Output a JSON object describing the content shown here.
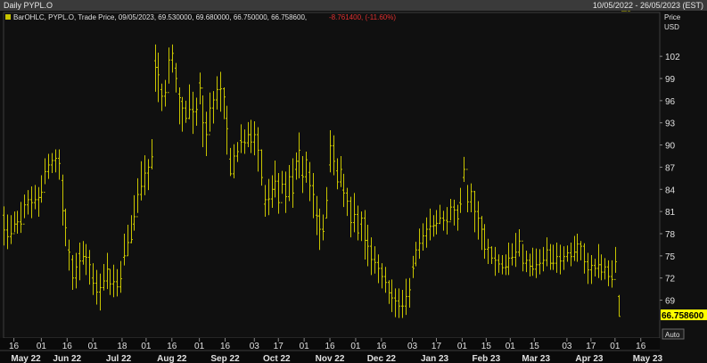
{
  "window": {
    "title": "Daily PYPL.O",
    "date_range": "10/05/2022 - 26/05/2023 (EST)"
  },
  "legend": {
    "series": "BarOHLC, PYPL.O, Trade Price, 09/05/2023, 69.530000, 69.680000, 66.750000, 66.758600,",
    "change": "-8.761400, (-11.60%)"
  },
  "axis": {
    "price_label": "Price",
    "currency_label": "USD",
    "last_price": "66.758600",
    "auto_button": "Auto"
  },
  "colors": {
    "background": "#101010",
    "bars": "#c8c400",
    "grid": "#2c2c2c",
    "text": "#e0e0e0",
    "change_negative": "#e03030",
    "last_price_badge": "#ffff00"
  },
  "chart_data": {
    "type": "ohlc_bar",
    "title": "Daily PYPL.O",
    "ylabel": "Price USD",
    "ylim": [
      64,
      106
    ],
    "yticks": [
      69,
      72,
      75,
      78,
      81,
      84,
      87,
      90,
      93,
      96,
      99,
      102
    ],
    "xlim": [
      "2022-05-10",
      "2023-05-26"
    ],
    "grid": false,
    "xticks": [
      {
        "date": "2022-05-16",
        "label": "16"
      },
      {
        "date": "2022-06-01",
        "label": "01"
      },
      {
        "date": "2022-06-16",
        "label": "16"
      },
      {
        "date": "2022-07-01",
        "label": "01"
      },
      {
        "date": "2022-07-18",
        "label": "18"
      },
      {
        "date": "2022-08-01",
        "label": "01"
      },
      {
        "date": "2022-08-16",
        "label": "16"
      },
      {
        "date": "2022-09-01",
        "label": "01"
      },
      {
        "date": "2022-09-16",
        "label": "16"
      },
      {
        "date": "2022-10-03",
        "label": "03"
      },
      {
        "date": "2022-10-17",
        "label": "17"
      },
      {
        "date": "2022-11-01",
        "label": "01"
      },
      {
        "date": "2022-11-16",
        "label": "16"
      },
      {
        "date": "2022-12-01",
        "label": "01"
      },
      {
        "date": "2022-12-16",
        "label": "16"
      },
      {
        "date": "2023-01-03",
        "label": "03"
      },
      {
        "date": "2023-01-17",
        "label": "17"
      },
      {
        "date": "2023-02-01",
        "label": "01"
      },
      {
        "date": "2023-02-15",
        "label": "15"
      },
      {
        "date": "2023-03-01",
        "label": "01"
      },
      {
        "date": "2023-03-15",
        "label": "15"
      },
      {
        "date": "2023-04-03",
        "label": "03"
      },
      {
        "date": "2023-04-17",
        "label": "17"
      },
      {
        "date": "2023-05-01",
        "label": "01"
      },
      {
        "date": "2023-05-16",
        "label": "16"
      }
    ],
    "months": [
      {
        "date": "2022-05-23",
        "label": "May 22"
      },
      {
        "date": "2022-06-16",
        "label": "Jun 22"
      },
      {
        "date": "2022-07-16",
        "label": "Jul 22"
      },
      {
        "date": "2022-08-16",
        "label": "Aug 22"
      },
      {
        "date": "2022-09-16",
        "label": "Sep 22"
      },
      {
        "date": "2022-10-16",
        "label": "Oct 22"
      },
      {
        "date": "2022-11-16",
        "label": "Nov 22"
      },
      {
        "date": "2022-12-16",
        "label": "Dec 22"
      },
      {
        "date": "2023-01-16",
        "label": "Jan 23"
      },
      {
        "date": "2023-02-15",
        "label": "Feb 23"
      },
      {
        "date": "2023-03-16",
        "label": "Mar 23"
      },
      {
        "date": "2023-04-16",
        "label": "Apr 23"
      },
      {
        "date": "2023-05-20",
        "label": "May 23"
      }
    ],
    "series": [
      {
        "name": "PYPL.O",
        "x": [
          "2022-05-10",
          "2022-05-12",
          "2022-05-14",
          "2022-05-16",
          "2022-05-18",
          "2022-05-20",
          "2022-05-22",
          "2022-05-24",
          "2022-05-26",
          "2022-05-28",
          "2022-05-30",
          "2022-06-01",
          "2022-06-03",
          "2022-06-05",
          "2022-06-07",
          "2022-06-09",
          "2022-06-11",
          "2022-06-13",
          "2022-06-15",
          "2022-06-17",
          "2022-06-19",
          "2022-06-21",
          "2022-06-23",
          "2022-06-25",
          "2022-06-27",
          "2022-06-29",
          "2022-07-01",
          "2022-07-03",
          "2022-07-05",
          "2022-07-07",
          "2022-07-09",
          "2022-07-11",
          "2022-07-13",
          "2022-07-15",
          "2022-07-17",
          "2022-07-19",
          "2022-07-21",
          "2022-07-23",
          "2022-07-25",
          "2022-07-27",
          "2022-07-29",
          "2022-07-31",
          "2022-08-02",
          "2022-08-04",
          "2022-08-06",
          "2022-08-08",
          "2022-08-10",
          "2022-08-12",
          "2022-08-14",
          "2022-08-16",
          "2022-08-18",
          "2022-08-20",
          "2022-08-22",
          "2022-08-24",
          "2022-08-26",
          "2022-08-28",
          "2022-08-30",
          "2022-09-01",
          "2022-09-03",
          "2022-09-05",
          "2022-09-07",
          "2022-09-09",
          "2022-09-11",
          "2022-09-13",
          "2022-09-15",
          "2022-09-17",
          "2022-09-19",
          "2022-09-21",
          "2022-09-23",
          "2022-09-25",
          "2022-09-27",
          "2022-09-29",
          "2022-10-01",
          "2022-10-03",
          "2022-10-05",
          "2022-10-07",
          "2022-10-09",
          "2022-10-11",
          "2022-10-13",
          "2022-10-15",
          "2022-10-17",
          "2022-10-19",
          "2022-10-21",
          "2022-10-23",
          "2022-10-25",
          "2022-10-27",
          "2022-10-29",
          "2022-10-31",
          "2022-11-02",
          "2022-11-04",
          "2022-11-06",
          "2022-11-08",
          "2022-11-10",
          "2022-11-12",
          "2022-11-14",
          "2022-11-16",
          "2022-11-18",
          "2022-11-20",
          "2022-11-22",
          "2022-11-24",
          "2022-11-26",
          "2022-11-28",
          "2022-11-30",
          "2022-12-02",
          "2022-12-04",
          "2022-12-06",
          "2022-12-08",
          "2022-12-10",
          "2022-12-12",
          "2022-12-14",
          "2022-12-16",
          "2022-12-18",
          "2022-12-20",
          "2022-12-22",
          "2022-12-24",
          "2022-12-26",
          "2022-12-28",
          "2022-12-30",
          "2023-01-01",
          "2023-01-03",
          "2023-01-05",
          "2023-01-07",
          "2023-01-09",
          "2023-01-11",
          "2023-01-13",
          "2023-01-15",
          "2023-01-17",
          "2023-01-19",
          "2023-01-21",
          "2023-01-23",
          "2023-01-25",
          "2023-01-27",
          "2023-01-29",
          "2023-01-31",
          "2023-02-02",
          "2023-02-04",
          "2023-02-06",
          "2023-02-08",
          "2023-02-10",
          "2023-02-12",
          "2023-02-14",
          "2023-02-16",
          "2023-02-18",
          "2023-02-20",
          "2023-02-22",
          "2023-02-24",
          "2023-02-26",
          "2023-02-28",
          "2023-03-02",
          "2023-03-04",
          "2023-03-06",
          "2023-03-08",
          "2023-03-10",
          "2023-03-12",
          "2023-03-14",
          "2023-03-16",
          "2023-03-18",
          "2023-03-20",
          "2023-03-22",
          "2023-03-24",
          "2023-03-26",
          "2023-03-28",
          "2023-03-30",
          "2023-04-01",
          "2023-04-03",
          "2023-04-05",
          "2023-04-07",
          "2023-04-09",
          "2023-04-11",
          "2023-04-13",
          "2023-04-15",
          "2023-04-17",
          "2023-04-19",
          "2023-04-21",
          "2023-04-23",
          "2023-04-25",
          "2023-04-27",
          "2023-04-29",
          "2023-05-01",
          "2023-05-03",
          "2023-05-05",
          "2023-05-07",
          "2023-05-09"
        ],
        "close": [
          78.5,
          77.6,
          78.0,
          79.3,
          79.6,
          79.3,
          81.9,
          82.6,
          82.2,
          82.6,
          82.9,
          83.6,
          86.4,
          87.3,
          87.9,
          88.2,
          87.5,
          81.1,
          78.8,
          75.5,
          72.0,
          73.5,
          74.3,
          74.9,
          74.8,
          73.8,
          71.3,
          70.1,
          70.7,
          71.6,
          73.2,
          71.2,
          71.5,
          70.8,
          71.9,
          75.0,
          76.8,
          77.2,
          80.3,
          83.3,
          84.4,
          86.2,
          87.0,
          88.4,
          100.5,
          99.5,
          96.6,
          97.1,
          101.5,
          102.4,
          99.0,
          96.4,
          95.0,
          93.6,
          94.8,
          94.5,
          94.8,
          97.7,
          93.0,
          91.4,
          95.0,
          96.1,
          97.5,
          97.6,
          96.5,
          92.2,
          86.1,
          88.5,
          89.1,
          90.4,
          90.3,
          91.4,
          90.4,
          91.4,
          89.3,
          85.6,
          82.6,
          82.7,
          84.0,
          85.1,
          82.2,
          84.7,
          83.0,
          85.7,
          83.5,
          87.8,
          89.3,
          85.7,
          88.0,
          84.5,
          83.3,
          80.4,
          78.6,
          78.3,
          82.5,
          89.9,
          87.8,
          85.0,
          86.7,
          83.5,
          82.4,
          79.5,
          80.6,
          78.1,
          80.1,
          77.1,
          76.3,
          74.5,
          74.1,
          73.3,
          72.2,
          71.4,
          70.0,
          69.3,
          68.9,
          68.2,
          68.2,
          69.5,
          70.4,
          73.3,
          75.8,
          76.7,
          77.7,
          78.6,
          79.0,
          79.1,
          79.4,
          80.1,
          79.8,
          79.6,
          81.6,
          81.2,
          80.0,
          82.0,
          86.7,
          82.3,
          83.7,
          81.0,
          80.1,
          78.6,
          75.9,
          76.1,
          74.7,
          74.4,
          73.9,
          73.4,
          73.5,
          74.7,
          74.8,
          75.5,
          77.0,
          74.0,
          74.4,
          73.6,
          73.2,
          73.8,
          74.0,
          74.4,
          75.8,
          74.0,
          74.0,
          74.9,
          74.3,
          74.9,
          75.4,
          74.9,
          75.5,
          76.6,
          76.3,
          74.2,
          73.1,
          73.7,
          73.3,
          73.8,
          72.8,
          73.5,
          72.2,
          71.8,
          74.2,
          66.8
        ],
        "high": [
          81.7,
          80.6,
          80.5,
          81.0,
          81.1,
          82.3,
          83.3,
          83.9,
          84.4,
          84.6,
          84.3,
          85.9,
          88.2,
          88.8,
          88.9,
          89.4,
          89.4,
          86.0,
          81.4,
          77.2,
          75.1,
          75.4,
          76.8,
          77.0,
          76.6,
          75.8,
          74.0,
          73.1,
          72.6,
          73.9,
          75.4,
          73.2,
          73.8,
          73.2,
          74.3,
          78.0,
          79.2,
          80.5,
          83.2,
          85.5,
          87.8,
          88.6,
          88.1,
          90.8,
          103.6,
          102.5,
          98.3,
          98.8,
          103.2,
          103.6,
          101.1,
          97.8,
          96.5,
          96.0,
          98.2,
          97.2,
          96.4,
          99.8,
          96.7,
          94.5,
          97.1,
          97.3,
          99.3,
          99.9,
          97.8,
          95.3,
          89.6,
          90.1,
          90.4,
          92.8,
          92.1,
          93.1,
          93.4,
          93.2,
          92.4,
          89.4,
          84.6,
          85.4,
          85.9,
          87.9,
          86.2,
          86.5,
          86.4,
          87.3,
          88.2,
          89.0,
          91.7,
          88.5,
          89.1,
          87.7,
          86.2,
          83.1,
          81.4,
          80.6,
          84.3,
          92.0,
          91.3,
          88.2,
          88.5,
          86.1,
          84.2,
          83.0,
          83.5,
          81.8,
          81.0,
          81.2,
          79.2,
          77.5,
          76.3,
          75.2,
          74.0,
          73.5,
          71.7,
          71.8,
          70.6,
          70.6,
          70.4,
          71.9,
          72.0,
          75.0,
          76.9,
          78.7,
          79.4,
          80.2,
          81.4,
          80.5,
          81.2,
          81.9,
          81.1,
          81.6,
          82.7,
          82.6,
          81.9,
          84.2,
          88.4,
          84.6,
          84.8,
          83.8,
          82.4,
          80.4,
          79.3,
          77.3,
          76.3,
          76.2,
          75.2,
          75.1,
          75.2,
          76.8,
          76.7,
          78.1,
          78.6,
          76.6,
          75.7,
          75.3,
          76.1,
          76.0,
          75.9,
          76.2,
          77.5,
          76.6,
          76.5,
          76.8,
          76.5,
          76.3,
          76.4,
          76.8,
          77.7,
          78.0,
          77.0,
          76.7,
          75.4,
          75.1,
          74.6,
          76.6,
          75.2,
          74.7,
          74.4,
          74.4,
          76.2,
          69.7
        ],
        "low": [
          76.4,
          75.9,
          76.6,
          78.2,
          78.0,
          78.1,
          80.1,
          80.6,
          80.1,
          81.3,
          80.3,
          82.2,
          84.7,
          85.4,
          86.2,
          86.3,
          85.3,
          79.1,
          76.3,
          73.0,
          70.4,
          70.6,
          71.7,
          73.8,
          72.4,
          71.1,
          69.7,
          68.4,
          67.6,
          70.3,
          70.5,
          69.7,
          69.4,
          69.5,
          70.0,
          73.7,
          75.0,
          76.7,
          78.4,
          80.8,
          82.5,
          83.2,
          83.9,
          86.7,
          97.2,
          95.8,
          94.6,
          95.2,
          98.3,
          99.8,
          97.1,
          92.8,
          91.8,
          93.0,
          93.5,
          91.5,
          92.6,
          95.5,
          89.7,
          88.5,
          91.8,
          92.9,
          94.8,
          94.5,
          93.5,
          88.7,
          85.8,
          85.5,
          87.7,
          88.9,
          88.8,
          89.7,
          88.9,
          88.6,
          86.4,
          84.5,
          80.3,
          80.5,
          81.5,
          82.9,
          80.7,
          83.4,
          80.8,
          82.4,
          81.5,
          85.3,
          85.5,
          83.5,
          84.9,
          82.4,
          80.1,
          77.8,
          75.8,
          77.1,
          80.1,
          86.3,
          85.9,
          84.0,
          84.3,
          81.6,
          80.4,
          77.5,
          78.2,
          77.1,
          77.0,
          74.5,
          73.6,
          72.4,
          72.6,
          71.3,
          70.6,
          70.0,
          68.5,
          67.4,
          66.7,
          66.6,
          66.6,
          67.0,
          68.0,
          72.0,
          73.6,
          74.6,
          75.7,
          76.1,
          77.1,
          77.6,
          77.9,
          79.3,
          78.4,
          77.9,
          79.8,
          79.1,
          78.4,
          80.8,
          85.0,
          80.9,
          80.9,
          78.2,
          77.2,
          75.8,
          74.6,
          73.9,
          73.9,
          72.3,
          72.7,
          72.5,
          72.4,
          72.4,
          73.7,
          73.5,
          74.9,
          72.9,
          72.8,
          72.2,
          72.3,
          72.0,
          72.5,
          72.9,
          73.6,
          73.1,
          73.1,
          72.7,
          72.5,
          73.1,
          74.2,
          73.6,
          74.3,
          74.2,
          74.4,
          72.6,
          71.2,
          71.2,
          72.2,
          72.0,
          71.7,
          71.8,
          70.9,
          70.7,
          72.7,
          66.8
        ],
        "open": [
          80.5,
          78.5,
          77.6,
          78.0,
          79.3,
          79.6,
          79.3,
          81.9,
          82.6,
          82.2,
          82.6,
          82.9,
          83.6,
          86.4,
          87.3,
          87.9,
          88.2,
          85.2,
          81.1,
          75.8,
          74.5,
          72.0,
          75.3,
          74.3,
          74.9,
          74.8,
          72.0,
          71.3,
          70.1,
          70.7,
          71.6,
          73.2,
          71.2,
          71.5,
          70.8,
          74.8,
          75.0,
          76.8,
          79.3,
          80.3,
          83.3,
          84.4,
          86.2,
          87.0,
          101.4,
          100.5,
          97.5,
          96.6,
          97.1,
          101.5,
          100.4,
          96.9,
          95.9,
          95.0,
          93.6,
          94.8,
          94.5,
          98.4,
          97.7,
          93.0,
          91.4,
          95.0,
          96.1,
          97.5,
          97.6,
          93.6,
          88.1,
          86.1,
          88.5,
          90.6,
          90.4,
          90.3,
          91.4,
          90.4,
          91.4,
          89.3,
          82.0,
          82.6,
          82.7,
          84.0,
          85.1,
          82.2,
          84.7,
          83.0,
          85.7,
          86.7,
          87.8,
          85.9,
          85.7,
          86.3,
          84.5,
          80.5,
          80.4,
          78.6,
          80.1,
          87.3,
          89.9,
          86.5,
          85.0,
          83.9,
          83.5,
          82.4,
          79.5,
          80.6,
          79.3,
          80.1,
          77.1,
          76.3,
          74.5,
          74.1,
          73.3,
          72.2,
          71.4,
          70.0,
          69.3,
          68.9,
          68.2,
          68.2,
          69.5,
          73.5,
          74.0,
          75.8,
          76.7,
          77.7,
          78.6,
          79.0,
          79.1,
          79.4,
          80.1,
          79.8,
          79.6,
          81.6,
          81.2,
          82.2,
          85.6,
          86.7,
          82.3,
          83.7,
          81.0,
          80.1,
          78.6,
          75.9,
          76.1,
          74.7,
          74.4,
          73.9,
          73.4,
          73.5,
          74.7,
          74.8,
          75.5,
          77.0,
          74.0,
          74.4,
          73.6,
          73.2,
          73.8,
          74.0,
          74.4,
          75.8,
          74.0,
          74.0,
          74.9,
          74.3,
          74.9,
          75.4,
          74.9,
          75.5,
          76.6,
          76.3,
          74.2,
          73.1,
          73.7,
          73.3,
          73.8,
          72.8,
          73.5,
          72.2,
          71.8,
          69.5
        ]
      }
    ]
  }
}
